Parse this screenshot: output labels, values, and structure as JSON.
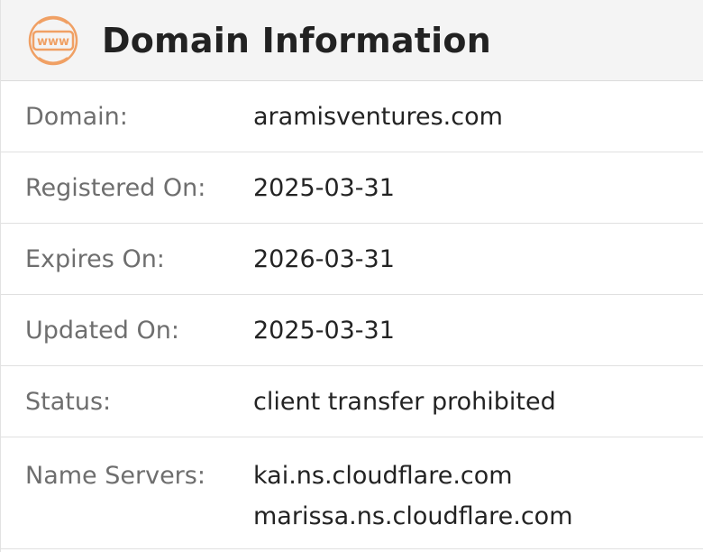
{
  "header": {
    "title": "Domain Information",
    "icon": "www-icon",
    "icon_text": "www",
    "icon_color": "#f0a064"
  },
  "rows": [
    {
      "label": "Domain:",
      "value": "aramisventures.com"
    },
    {
      "label": "Registered On:",
      "value": "2025-03-31"
    },
    {
      "label": "Expires On:",
      "value": "2026-03-31"
    },
    {
      "label": "Updated On:",
      "value": "2025-03-31"
    },
    {
      "label": "Status:",
      "value": "client transfer prohibited"
    }
  ],
  "name_servers": {
    "label": "Name Servers:",
    "values": [
      "kai.ns.cloudflare.com",
      "marissa.ns.cloudflare.com"
    ]
  }
}
